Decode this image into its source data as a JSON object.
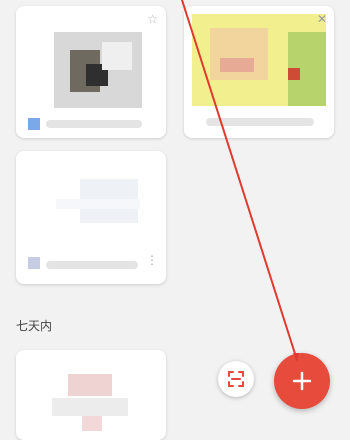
{
  "section": {
    "label": "七天内"
  },
  "colors": {
    "background": "#f2f2f2",
    "fab_red": "#e64b3c",
    "arrow_red": "#e0392d"
  },
  "icons": {
    "star": "star-icon",
    "close": "close-icon",
    "more": "more-vertical-icon",
    "scan": "scan-document-icon",
    "add": "add-icon"
  }
}
